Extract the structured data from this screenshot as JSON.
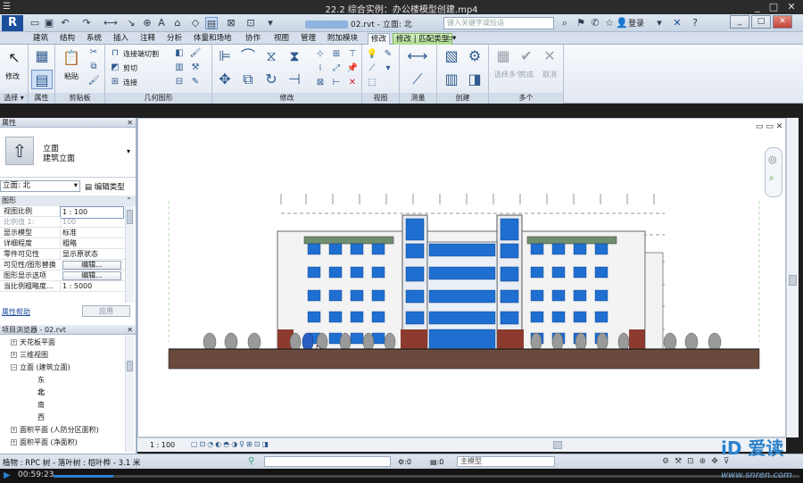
{
  "player": {
    "title": "22.2  综合实例：办公楼模型创建.mp4",
    "controls": [
      "_",
      "□",
      "✕"
    ]
  },
  "revit": {
    "file_title": "02.rvt - 立面: 北",
    "search_placeholder": "键入关键字或短语",
    "login": "登录",
    "tabs": [
      "建筑",
      "结构",
      "系统",
      "插入",
      "注释",
      "分析",
      "体量和场地",
      "协作",
      "视图",
      "管理",
      "附加模块",
      "修改",
      "修改 | 匹配类型"
    ],
    "active_tab": "修改",
    "ribbon": {
      "select_label": "修改",
      "select_panel": "选择 ▾",
      "properties_panel": "属性",
      "clipboard_panel": "剪贴板",
      "paste_label": "粘贴",
      "geometry_panel": "几何图形",
      "geometry_items": [
        "连接端切割",
        "剪切",
        "连接"
      ],
      "modify_panel": "修改",
      "view_panel": "视图",
      "measure_panel": "测量",
      "create_panel": "创建",
      "multiple_panel": "多个",
      "multiple_items": [
        "选择多个",
        "完成",
        "取消"
      ]
    },
    "properties": {
      "header": "属性",
      "type_name_1": "立面",
      "type_name_2": "建筑立面",
      "selector_value": "立面: 北",
      "edit_type": "编辑类型",
      "group": "图形",
      "rows": [
        {
          "k": "视图比例",
          "v": "1 : 100"
        },
        {
          "k": "比例值 1:",
          "v": "100"
        },
        {
          "k": "显示模型",
          "v": "标准"
        },
        {
          "k": "详细程度",
          "v": "粗略"
        },
        {
          "k": "零件可见性",
          "v": "显示原状态"
        },
        {
          "k": "可见性/图形替换",
          "v": "编辑..."
        },
        {
          "k": "图形显示选项",
          "v": "编辑..."
        },
        {
          "k": "当比例粗略度...",
          "v": "1 : 5000"
        }
      ],
      "help": "属性帮助",
      "apply": "应用"
    },
    "browser": {
      "header": "项目浏览器 - 02.rvt",
      "items": [
        {
          "label": "天花板平面",
          "level": 1,
          "exp": "+"
        },
        {
          "label": "三维视图",
          "level": 1,
          "exp": "+"
        },
        {
          "label": "立面 (建筑立面)",
          "level": 1,
          "exp": "−"
        },
        {
          "label": "东",
          "level": 2,
          "exp": ""
        },
        {
          "label": "北",
          "level": 2,
          "exp": "",
          "bold": true
        },
        {
          "label": "南",
          "level": 2,
          "exp": ""
        },
        {
          "label": "西",
          "level": 2,
          "exp": ""
        },
        {
          "label": "面积平面 (人防分区面积)",
          "level": 1,
          "exp": "+"
        },
        {
          "label": "面积平面 (净面积)",
          "level": 1,
          "exp": "+"
        }
      ]
    },
    "view_scale": "1 : 100",
    "status_text": "植物 : RPC 树 - 落叶树 : 桤叶桦 - 3.1 米",
    "status_zero_1": ":0",
    "status_zero_2": ":0",
    "main_model": "主模型"
  },
  "video": {
    "current_time": "00:59:23",
    "progress": 0.08
  },
  "watermark": {
    "brand": "iD 爱读",
    "url": "www.snren.com"
  },
  "colors": {
    "glass": "#1f6fd1",
    "accent": "#2a7fd4"
  }
}
